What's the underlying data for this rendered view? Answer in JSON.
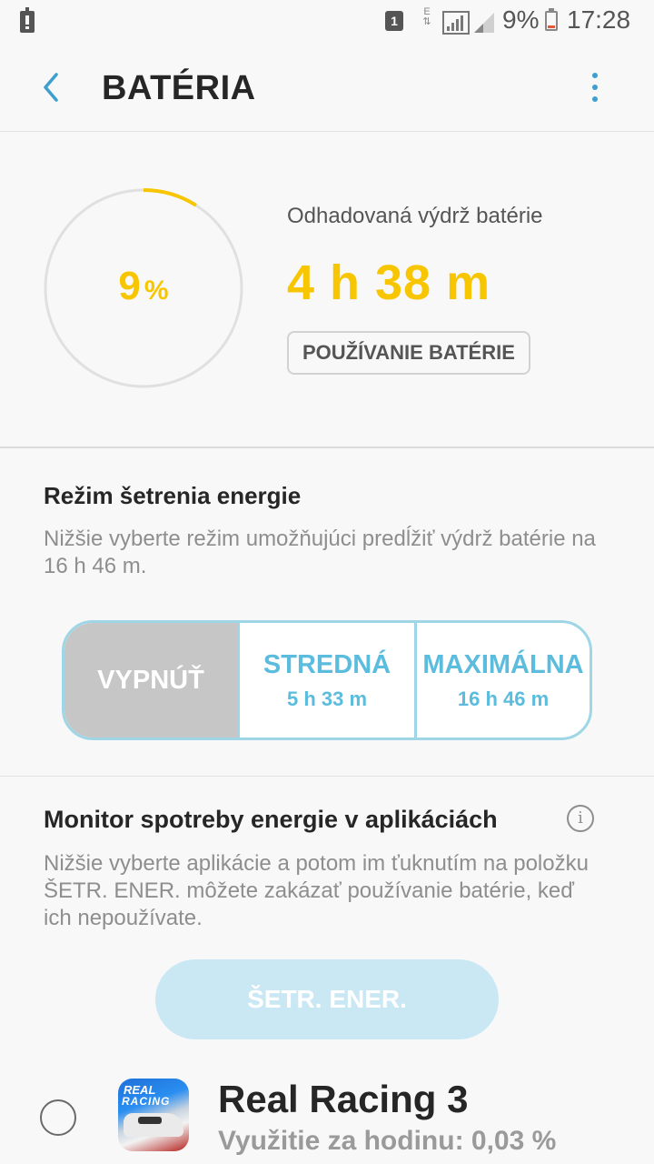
{
  "status_bar": {
    "sim": "1",
    "network": "E",
    "battery_pct": "9%",
    "time": "17:28"
  },
  "header": {
    "title": "BATÉRIA",
    "back_icon": "chevron-left-icon",
    "more_icon": "more-vert-icon"
  },
  "battery": {
    "percent_value": "9",
    "percent_unit": "%",
    "level_fraction": 0.09,
    "estimate_label": "Odhadovaná výdrž batérie",
    "estimate_value": "4 h 38 m",
    "usage_button": "POUŽÍVANIE BATÉRIE",
    "colors": {
      "accent": "#f8c600",
      "ring_track": "#e0e0e0"
    }
  },
  "power_saving": {
    "title": "Režim šetrenia energie",
    "description": "Nižšie vyberte režim umožňujúci predĺžiť výdrž batérie na 16 h 46 m.",
    "modes": [
      {
        "name": "VYPNÚŤ",
        "time": "",
        "selected": true
      },
      {
        "name": "STREDNÁ",
        "time": "5 h 33 m",
        "selected": false
      },
      {
        "name": "MAXIMÁLNA",
        "time": "16 h 46 m",
        "selected": false
      }
    ],
    "colors": {
      "accent": "#5bbcdd",
      "border": "#9fd6e6",
      "selected_bg": "#c6c6c6"
    }
  },
  "monitor": {
    "title": "Monitor spotreby energie v aplikáciách",
    "info_icon": "info-icon",
    "description": "Nižšie vyberte aplikácie a potom im ťuknutím na položku ŠETR. ENER. môžete zakázať používanie batérie, keď ich nepoužívate.",
    "save_button": "ŠETR. ENER."
  },
  "apps": [
    {
      "icon_text_1": "REAL",
      "icon_text_2": "RACING",
      "name": "Real Racing 3",
      "usage": "Využitie za hodinu: 0,03 %",
      "checked": false
    }
  ]
}
